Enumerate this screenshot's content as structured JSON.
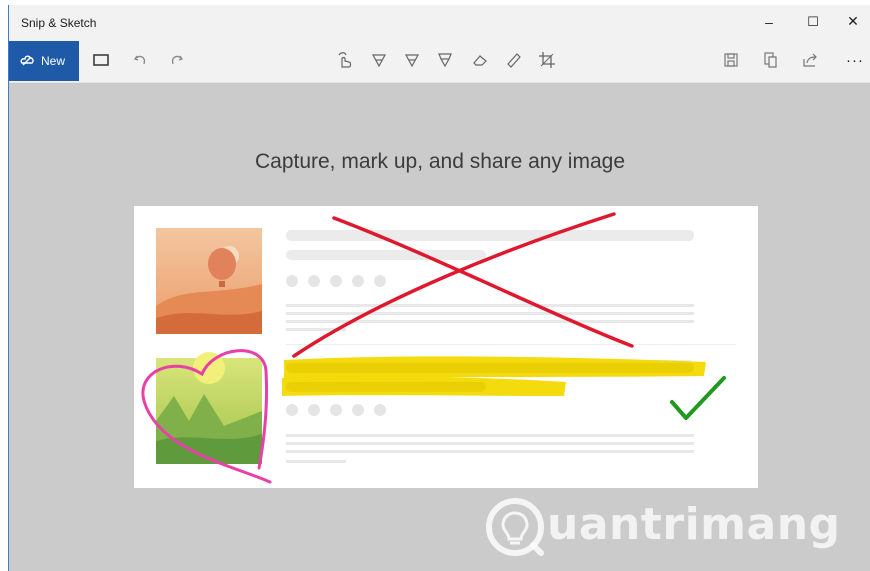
{
  "window": {
    "title": "Snip & Sketch"
  },
  "window_controls": {
    "minimize": "–",
    "maximize": "☐",
    "close": "✕"
  },
  "toolbar": {
    "new_label": "New",
    "more_label": "···",
    "tools": [
      {
        "name": "snip-mode-icon"
      },
      {
        "name": "undo-icon"
      },
      {
        "name": "redo-icon"
      },
      {
        "name": "touch-writing-icon"
      },
      {
        "name": "ballpoint-pen-icon"
      },
      {
        "name": "pencil-icon"
      },
      {
        "name": "highlighter-icon"
      },
      {
        "name": "eraser-icon"
      },
      {
        "name": "ruler-icon"
      },
      {
        "name": "crop-icon"
      },
      {
        "name": "save-icon"
      },
      {
        "name": "copy-icon"
      },
      {
        "name": "share-icon"
      }
    ]
  },
  "main": {
    "caption": "Capture, mark up, and share any image"
  },
  "watermark": {
    "text": "uantrimang"
  },
  "colors": {
    "accent": "#1e5aa8",
    "markup_red": "#e0182d",
    "markup_yellow": "#f3d900",
    "markup_green": "#1f9a1f",
    "markup_pink": "#e83fa8"
  }
}
